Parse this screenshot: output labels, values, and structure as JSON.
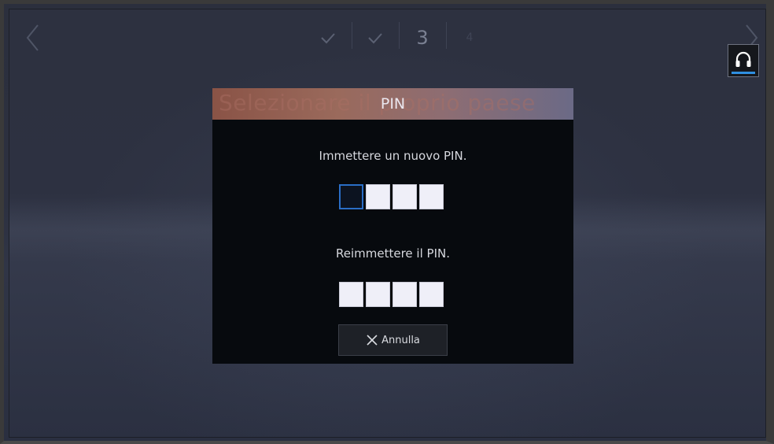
{
  "navigation": {
    "back_icon": "chevron-left-icon",
    "forward_icon": "chevron-right-icon"
  },
  "steps": [
    {
      "label": "✓",
      "state": "done"
    },
    {
      "label": "✓",
      "state": "done"
    },
    {
      "label": "3",
      "state": "current"
    },
    {
      "label": "4",
      "state": "future"
    }
  ],
  "accessibility": {
    "icon": "headset-icon",
    "accent_color": "#2f8fe0"
  },
  "background": {
    "ghost_title": "Selezionare il proprio paese"
  },
  "dialog": {
    "title": "PIN",
    "new_pin_prompt": "Immettere un nuovo PIN.",
    "confirm_pin_prompt": "Reimmettere il PIN.",
    "new_pin_digits": 4,
    "confirm_pin_digits": 4,
    "cancel_label": "Annulla",
    "cancel_icon": "close-icon",
    "header_colors": [
      "#8a5346",
      "#6b6a86"
    ],
    "focus_color": "#2a6ec6"
  }
}
